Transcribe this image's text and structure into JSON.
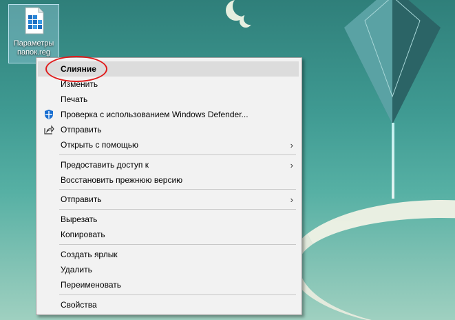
{
  "desktop_icon": {
    "label": "Параметры папок.reg"
  },
  "context_menu": {
    "items": [
      {
        "label": "Слияние"
      },
      {
        "label": "Изменить"
      },
      {
        "label": "Печать"
      },
      {
        "label": "Проверка с использованием Windows Defender..."
      },
      {
        "label": "Отправить"
      },
      {
        "label": "Открыть с помощью"
      },
      {
        "label": "Предоставить доступ к"
      },
      {
        "label": "Восстановить прежнюю версию"
      },
      {
        "label": "Отправить"
      },
      {
        "label": "Вырезать"
      },
      {
        "label": "Копировать"
      },
      {
        "label": "Создать ярлык"
      },
      {
        "label": "Удалить"
      },
      {
        "label": "Переименовать"
      },
      {
        "label": "Свойства"
      }
    ],
    "submenu_arrow": "›"
  },
  "colors": {
    "annotation": "#e01b1b",
    "highlight": "#dcdcdc",
    "menu_bg": "#f2f2f2"
  }
}
